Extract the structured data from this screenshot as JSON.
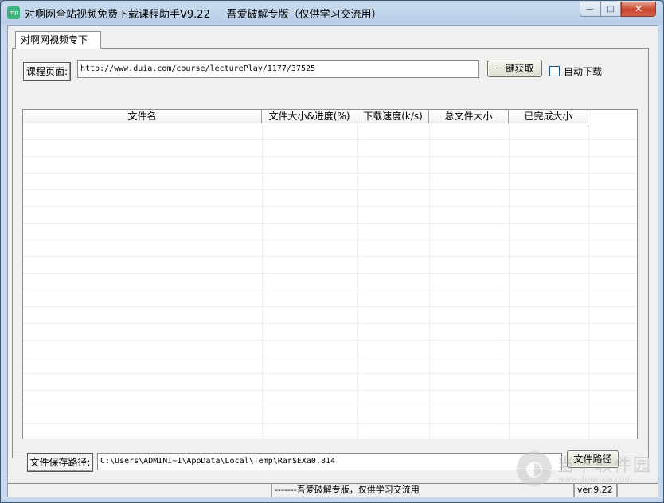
{
  "window": {
    "icon_text": "mp",
    "title": "对啊网全站视频免费下载课程助手V9.22     吾爱破解专版（仅供学习交流用）",
    "minimize_glyph": "—",
    "maximize_glyph": "□",
    "close_glyph": "✕"
  },
  "tabs": [
    {
      "label": "对啊网视频专下"
    }
  ],
  "course_page": {
    "label": "课程页面:",
    "url_value": "http://www.duia.com/course/lecturePlay/1177/37525",
    "fetch_button": "一键获取",
    "auto_download_label": "自动下载",
    "auto_download_checked": false
  },
  "table": {
    "columns": [
      "文件名",
      "文件大小&进度(%)",
      "下载速度(k/s)",
      "总文件大小",
      "已完成大小"
    ],
    "rows": []
  },
  "save_path": {
    "label": "文件保存路径:",
    "value": "C:\\Users\\ADMINI~1\\AppData\\Local\\Temp\\Rar$EXa0.814",
    "button": "文件路径"
  },
  "status_bar": {
    "cells": [
      "",
      "-------吾爱破解专版，仅供学习交流用",
      "ver.9.22"
    ]
  },
  "watermark": {
    "logo_glyph": "◐",
    "text": "当下软件园",
    "url": "www.downxia.com"
  }
}
